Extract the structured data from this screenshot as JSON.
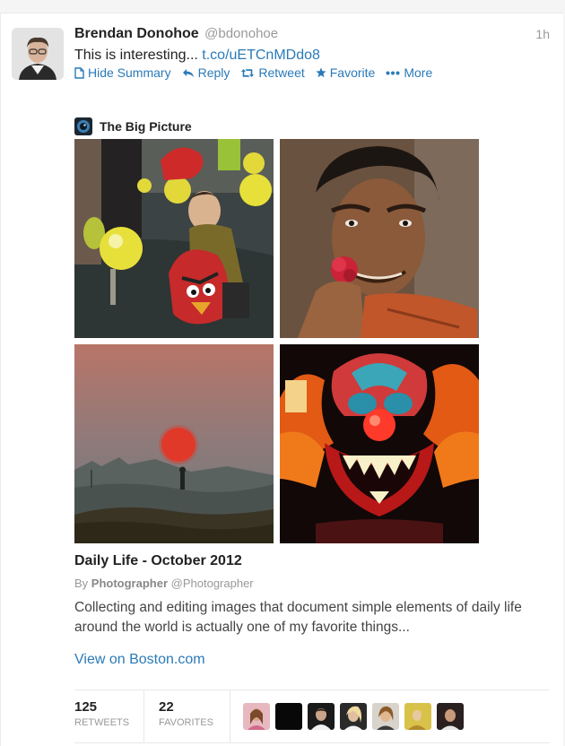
{
  "tweet": {
    "author_name": "Brendan Donohoe",
    "author_handle": "@bdonohoe",
    "timestamp": "1h",
    "text_prefix": "This is interesting...",
    "link": "t.co/uETCnMDdo8"
  },
  "actions": {
    "hide_summary": "Hide Summary",
    "reply": "Reply",
    "retweet": "Retweet",
    "favorite": "Favorite",
    "more": "More"
  },
  "card": {
    "source_name": "The Big Picture",
    "article_title": "Daily Life - October 2012",
    "byline_prefix": "By",
    "byline_name": "Photographer",
    "byline_handle": "@Photographer",
    "description": "Collecting and editing images that document simple elements of daily life around the world is actually one of my favorite things...",
    "view_link": "View on Boston.com"
  },
  "stats": {
    "retweets_count": "125",
    "retweets_label": "RETWEETS",
    "favorites_count": "22",
    "favorites_label": "FAVORITES"
  },
  "icons": {
    "hide_summary": "document-icon",
    "reply": "reply-arrow-icon",
    "retweet": "retweet-icon",
    "favorite": "star-icon",
    "more": "ellipsis-icon"
  },
  "colors": {
    "link": "#2a7ab8",
    "muted": "#999999",
    "text": "#222222"
  }
}
